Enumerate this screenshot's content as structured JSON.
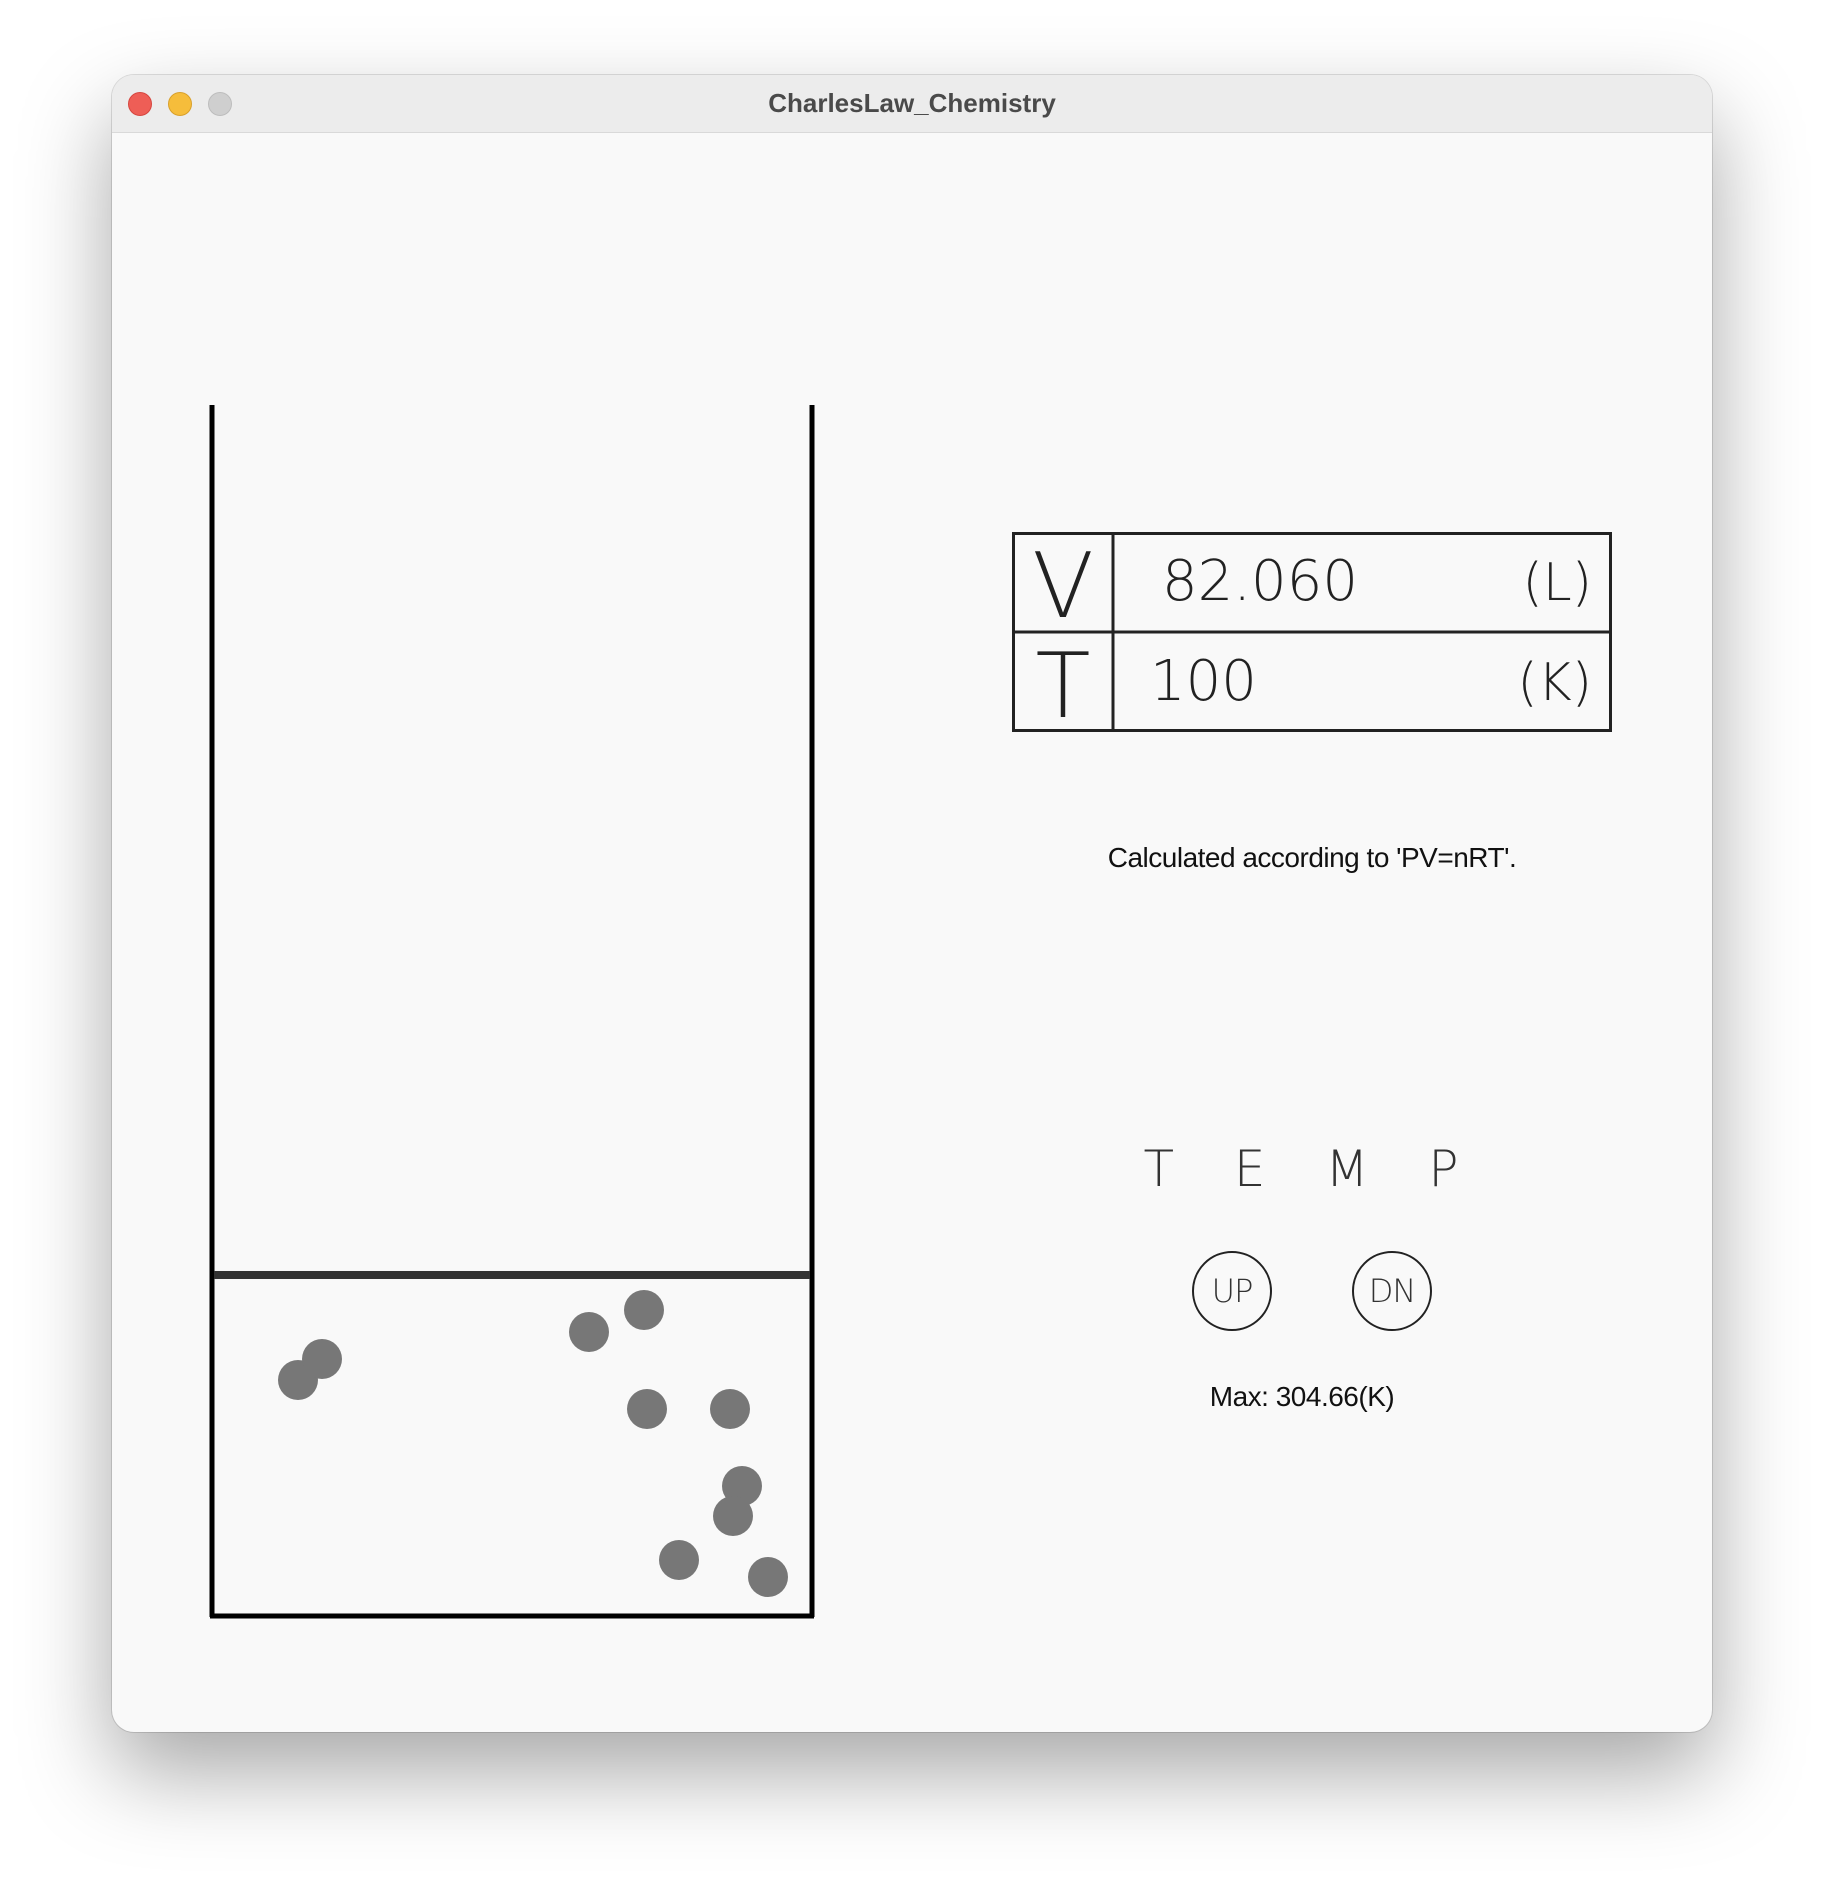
{
  "window": {
    "title": "CharlesLaw_Chemistry"
  },
  "colors": {
    "particle": "#777777",
    "container": "#000000",
    "piston": "#333333",
    "background": "#f9f9f9"
  },
  "readout": {
    "volume": {
      "symbol": "V",
      "value": "82.060",
      "unit": "(L)"
    },
    "temperature": {
      "symbol": "T",
      "value": "100",
      "unit": "(K)"
    }
  },
  "note": "Calculated according to 'PV=nRT'.",
  "controls": {
    "label": "T E M P",
    "up_label": "UP",
    "down_label": "DN",
    "max_text": "Max: 304.66(K)"
  }
}
